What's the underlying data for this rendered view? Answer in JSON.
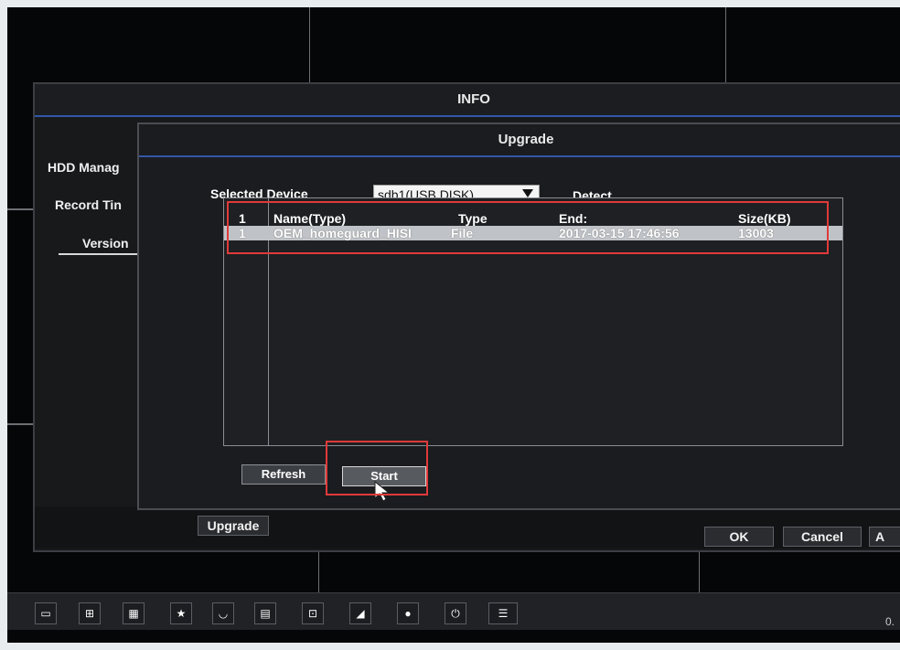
{
  "info_window": {
    "title": "INFO",
    "tabs": [
      "HDD Manag",
      "Record Tin",
      "Version"
    ],
    "bottom_buttons": {
      "upgrade": "Upgrade",
      "ok": "OK",
      "cancel": "Cancel",
      "apply": "A"
    }
  },
  "upgrade_dialog": {
    "title": "Upgrade",
    "selected_device_label": "Selected Device",
    "selected_device_value": "sdb1(USB DISK)",
    "detect_label": "Detect",
    "list": {
      "headers": [
        "1",
        "Name(Type)",
        "Type",
        "End:",
        "Size(KB)"
      ],
      "rows": [
        [
          "1",
          "OEM_homeguard_HISI",
          "File",
          "2017-03-15 17:46:56",
          "13003"
        ]
      ]
    },
    "refresh_label": "Refresh",
    "start_label": "Start"
  },
  "taskbar": {
    "icons": [
      "single-view-icon",
      "quad-view-icon",
      "nine-view-icon",
      "star-icon",
      "ptz-icon",
      "playback-icon",
      "record-icon",
      "camera-icon",
      "alarm-icon",
      "power-icon",
      "user-icon"
    ],
    "clock_fragment": "0."
  },
  "colors": {
    "highlight_border": "#e03a3a",
    "title_accent": "#3357a8",
    "selected_row": "#bfc2c6"
  }
}
